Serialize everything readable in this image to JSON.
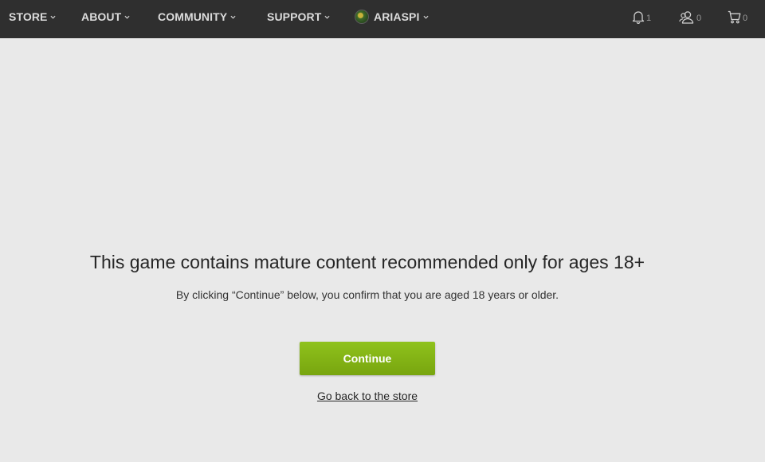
{
  "nav": {
    "store": "STORE",
    "about": "ABOUT",
    "community": "COMMUNITY",
    "support": "SUPPORT",
    "user": "ARIASPI"
  },
  "icons": {
    "notifications": {
      "icon": "bell-icon",
      "count": "1"
    },
    "friends": {
      "icon": "friends-icon",
      "count": "0"
    },
    "cart": {
      "icon": "cart-icon",
      "count": "0"
    }
  },
  "age_gate": {
    "headline": "This game contains mature content recommended only for ages 18+",
    "message": "By clicking “Continue” below, you confirm that you are aged 18 years or older.",
    "continue_label": "Continue",
    "back_label": "Go back to the store"
  },
  "colors": {
    "topbar": "#2f2f2f",
    "background": "#e9e9e9",
    "accent": "#86b818"
  }
}
